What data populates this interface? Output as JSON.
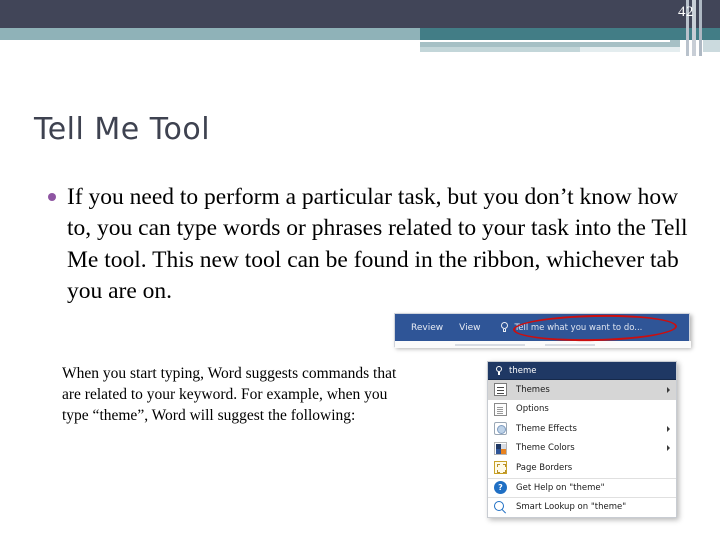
{
  "slide": {
    "page_number": "42",
    "title": "Tell Me Tool",
    "bullet": "If you need to perform a particular task, but you don’t know how to, you can type words or phrases related to your task into the Tell Me tool. This new tool can be found in the ribbon, whichever tab you are on.",
    "sub_paragraph": "When you start typing, Word suggests commands that are related to your keyword. For example, when you type “theme”, Word will suggest the following:"
  },
  "colors": {
    "band_dark": "#414558",
    "band_teal": "#427d86",
    "band_teal_light": "#8fb2b8",
    "title": "#3e4250",
    "bullet_dot": "#8e55a2",
    "ribbon_blue": "#2f5597",
    "menu_header": "#1f3864",
    "annotation_red": "#cc0e0e"
  },
  "ribbon_screenshot": {
    "tabs": [
      {
        "label": "Review"
      },
      {
        "label": "View"
      }
    ],
    "tell_me": {
      "icon": "lightbulb-icon",
      "label": "Tell me what you want to do..."
    },
    "annotation": "red-ellipse-highlight"
  },
  "suggest_menu": {
    "search": {
      "icon": "lightbulb-icon",
      "value": "theme"
    },
    "items": [
      {
        "label": "Themes",
        "icon": "themes-icon",
        "has_submenu": true,
        "highlighted": true,
        "separator_above": false
      },
      {
        "label": "Options",
        "icon": "options-doc-icon",
        "has_submenu": false,
        "highlighted": false,
        "separator_above": false
      },
      {
        "label": "Theme Effects",
        "icon": "theme-effects-icon",
        "has_submenu": true,
        "highlighted": false,
        "separator_above": false
      },
      {
        "label": "Theme Colors",
        "icon": "theme-colors-icon",
        "has_submenu": true,
        "highlighted": false,
        "separator_above": false
      },
      {
        "label": "Page Borders",
        "icon": "page-borders-icon",
        "has_submenu": false,
        "highlighted": false,
        "separator_above": false
      },
      {
        "label": "Get Help on \"theme\"",
        "icon": "help-icon",
        "has_submenu": false,
        "highlighted": false,
        "separator_above": true
      },
      {
        "label": "Smart Lookup on \"theme\"",
        "icon": "smart-lookup-icon",
        "has_submenu": false,
        "highlighted": false,
        "separator_above": true
      }
    ]
  }
}
